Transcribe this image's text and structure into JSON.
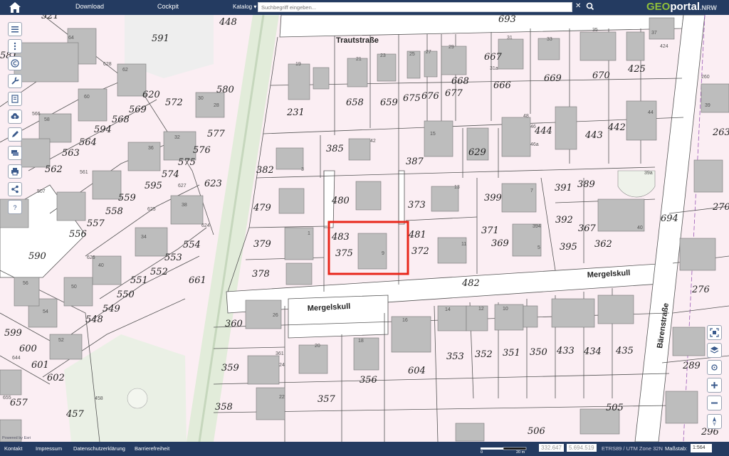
{
  "toolbar": {
    "download_label": "Download",
    "cockpit_label": "Cockpit",
    "katalog_label": "Katalog",
    "search_placeholder": "Suchbegriff eingeben...",
    "logo_geo": "GEO",
    "logo_portal": "portal",
    "logo_suffix": ".NRW"
  },
  "footer": {
    "kontakt": "Kontakt",
    "impressum": "Impressum",
    "datenschutz": "Datenschutzerklärung",
    "barrierefreiheit": "Barrierefreiheit",
    "coord_x": "332.647",
    "coord_y": "5.694.519",
    "crs": "ETRS89 / UTM Zone 32N",
    "massstab_label": "Maßstab:",
    "massstab_value": "1:564",
    "scale_zero": "0",
    "scale_value": "20 m",
    "powered_by": "Powered by Esri"
  },
  "map": {
    "streets": [
      "Trautstraße",
      "Mergelskull",
      "Mergelskull",
      "Bärenstraße"
    ],
    "parcels": [
      "521",
      "448",
      "693",
      "591",
      "581",
      "628",
      "620",
      "572",
      "580",
      "566",
      "569",
      "594",
      "568",
      "577",
      "563",
      "564",
      "562",
      "576",
      "574",
      "575",
      "561",
      "507",
      "595",
      "627",
      "623",
      "559",
      "625",
      "558",
      "557",
      "556",
      "624",
      "554",
      "553",
      "626",
      "552",
      "551",
      "550",
      "549",
      "548",
      "599",
      "600",
      "644",
      "601",
      "602",
      "655",
      "657",
      "458",
      "457",
      "590",
      "661",
      "231",
      "658",
      "659",
      "675",
      "676",
      "677",
      "668",
      "667",
      "666",
      "669",
      "670",
      "425",
      "424",
      "260",
      "385",
      "387",
      "629",
      "444",
      "443",
      "442",
      "263",
      "382",
      "480",
      "373",
      "399",
      "391",
      "389",
      "479",
      "483",
      "375",
      "481",
      "372",
      "371",
      "394",
      "392",
      "367",
      "270",
      "694",
      "379",
      "378",
      "369",
      "395",
      "362",
      "482",
      "276",
      "360",
      "361",
      "359",
      "358",
      "357",
      "356",
      "604",
      "353",
      "352",
      "351",
      "350",
      "433",
      "434",
      "435",
      "289",
      "505",
      "506",
      "296"
    ],
    "house_numbers": [
      "19",
      "21",
      "23",
      "25",
      "27",
      "29",
      "31",
      "33",
      "35",
      "37",
      "39",
      "31a",
      "39a",
      "40",
      "48",
      "46",
      "46a",
      "44",
      "42",
      "15",
      "13",
      "11",
      "9",
      "7",
      "5",
      "3",
      "1",
      "10",
      "12",
      "14",
      "16",
      "18",
      "20",
      "22",
      "24",
      "26",
      "28",
      "30",
      "32",
      "36",
      "38",
      "34",
      "40",
      "50",
      "52",
      "54",
      "56",
      "58",
      "60",
      "62",
      "64"
    ],
    "highlight_color": "#e8271b",
    "parcel_fill": "#fbeef3",
    "building_fill": "#bdbdbd",
    "green_fill": "#e2ecda"
  },
  "tools_left": [
    "list-icon",
    "more-vertical-icon",
    "copyright-icon",
    "wrench-icon",
    "document-icon",
    "upload-cloud-icon",
    "pencil-icon",
    "layers-stack-icon",
    "printer-icon",
    "share-icon",
    "help-icon"
  ],
  "tools_right": [
    "home-extent-icon",
    "layers-icon",
    "locate-icon",
    "zoom-in-icon",
    "zoom-out-icon",
    "north-arrow-icon"
  ]
}
